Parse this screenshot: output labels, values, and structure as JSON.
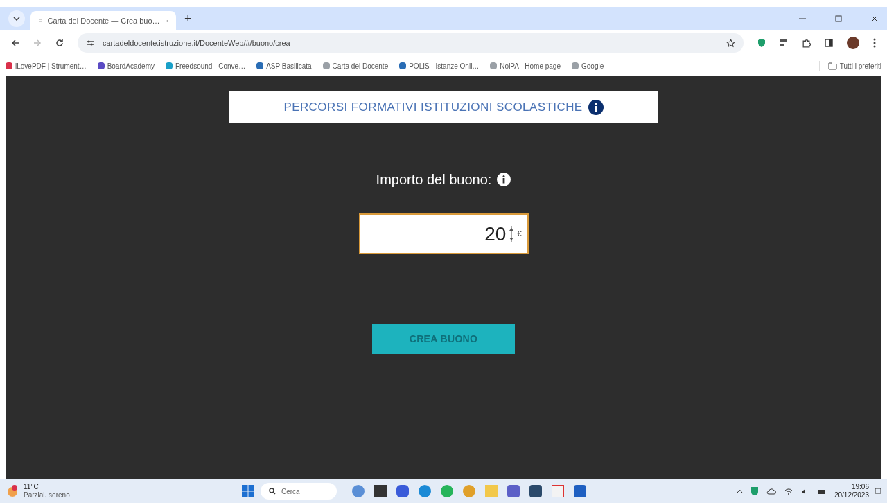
{
  "browser": {
    "tab": {
      "title": "Carta del Docente — Crea buo…",
      "selected": true
    },
    "new_tab": "+",
    "url": "cartadeldocente.istruzione.it/DocenteWeb/#/buono/crea",
    "bookmarks": [
      {
        "label": "iLovePDF | Strument…",
        "color": "#d9304a"
      },
      {
        "label": "BoardAcademy",
        "color": "#5b4bc4"
      },
      {
        "label": "Freedsound - Conve…",
        "color": "#1aa0c8"
      },
      {
        "label": "ASP Basilicata",
        "color": "#2a6db5"
      },
      {
        "label": "Carta del Docente",
        "color": "#9aa0a6"
      },
      {
        "label": "POLIS - Istanze Onli…",
        "color": "#2a6db5"
      },
      {
        "label": "NoiPA - Home page",
        "color": "#9aa0a6"
      },
      {
        "label": "Google",
        "color": "#9aa0a6"
      }
    ],
    "all_bookmarks": "Tutti i preferiti"
  },
  "page": {
    "category": "PERCORSI FORMATIVI ISTITUZIONI SCOLASTICHE",
    "amount_label": "Importo del buono:",
    "amount": {
      "value": "20",
      "unit": "€"
    },
    "submit": "CREA BUONO"
  },
  "taskbar": {
    "weather": {
      "temp": "11°C",
      "condition": "Parzial. sereno"
    },
    "search": "Cerca",
    "time": "19:06",
    "date": "20/12/2023"
  }
}
